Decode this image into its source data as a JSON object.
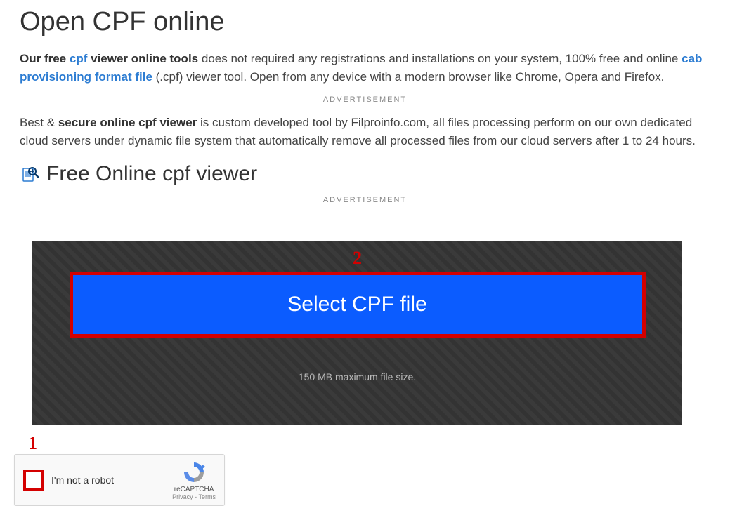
{
  "title": "Open CPF online",
  "para1": {
    "a": "Our free ",
    "link1": "cpf",
    "b": " viewer online tools",
    "c": " does not required any registrations and installations on your system, 100% free and online ",
    "link2": "cab provisioning format file",
    "d": " (.cpf) viewer tool. Open from any device with a modern browser like Chrome, Opera and Firefox."
  },
  "ad_label": "ADVERTISEMENT",
  "para2": {
    "a": "Best & ",
    "b": "secure online cpf viewer",
    "c": " is custom developed tool by Filproinfo.com, all files processing perform on our own dedicated cloud servers under dynamic file system that automatically remove all processed files from our cloud servers after 1 to 24 hours."
  },
  "section_heading": "Free Online cpf viewer",
  "annot1": "1",
  "annot2": "2",
  "select_button": "Select CPF file",
  "max_size": "150 MB maximum file size.",
  "recaptcha": {
    "label": "I'm not a robot",
    "brand": "reCAPTCHA",
    "links": "Privacy - Terms"
  }
}
